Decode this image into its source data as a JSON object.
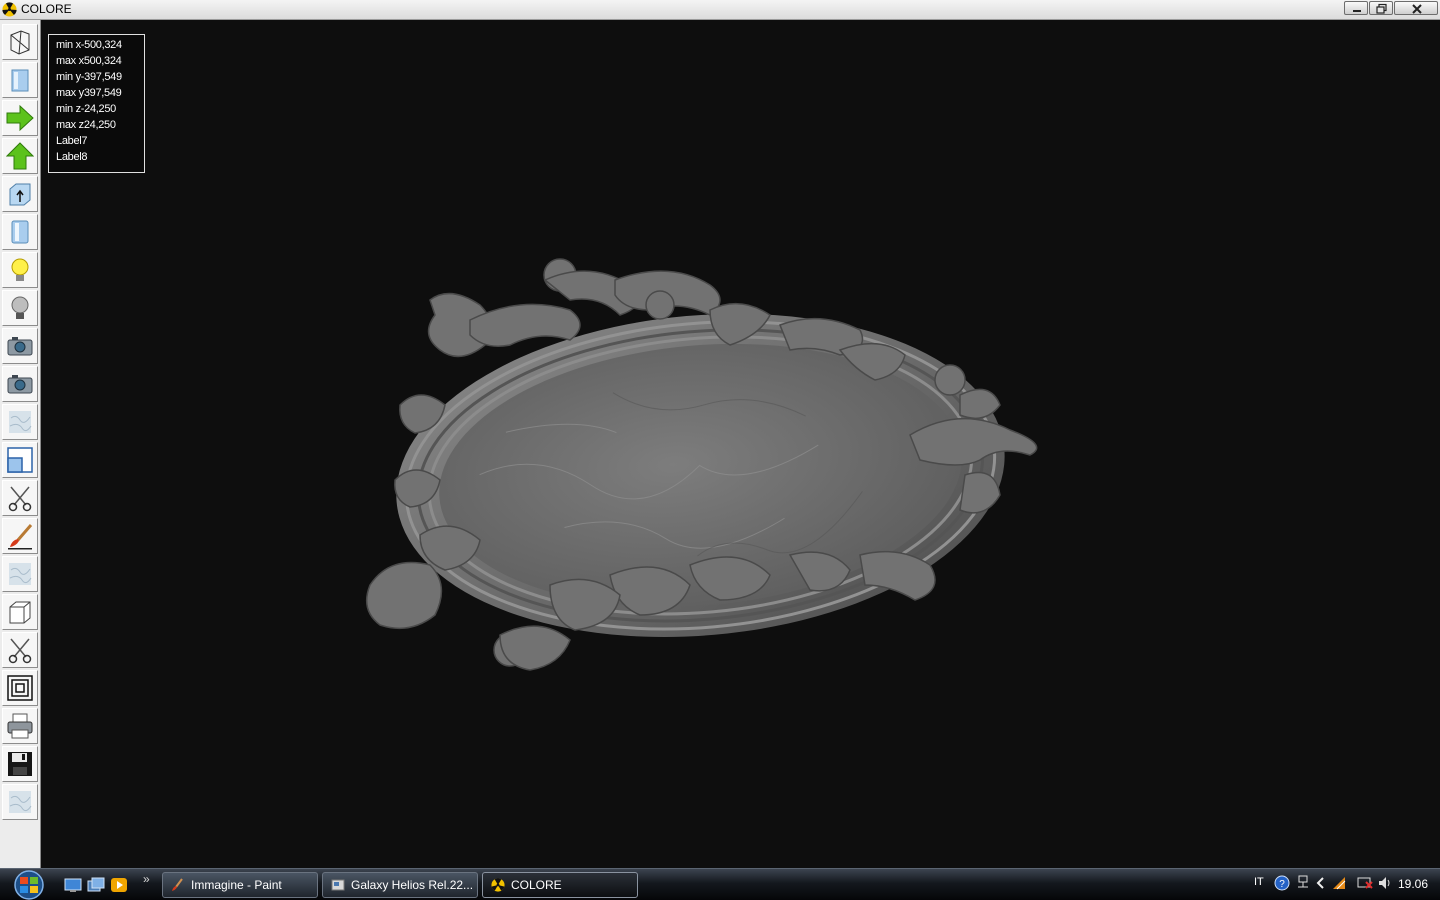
{
  "window": {
    "title": "COLORE",
    "icon": "radiation-icon"
  },
  "window_controls": [
    "minimize",
    "restore",
    "close"
  ],
  "toolbar": {
    "tools": [
      {
        "icon": "wireframe-icon"
      },
      {
        "icon": "solid-box-icon"
      },
      {
        "icon": "arrow-right-icon"
      },
      {
        "icon": "arrow-up-icon"
      },
      {
        "icon": "box-normal-icon"
      },
      {
        "icon": "cylinder-icon"
      },
      {
        "icon": "lightbulb-on-icon"
      },
      {
        "icon": "lightbulb-off-icon"
      },
      {
        "icon": "camera-icon"
      },
      {
        "icon": "camera-2-icon"
      },
      {
        "icon": "texture-icon"
      },
      {
        "icon": "resize-icon"
      },
      {
        "icon": "scissors-icon"
      },
      {
        "icon": "brush-icon"
      },
      {
        "icon": "texture-2-icon"
      },
      {
        "icon": "cube-icon"
      },
      {
        "icon": "scissors-2-icon"
      },
      {
        "icon": "nested-squares-icon"
      },
      {
        "icon": "printer-icon"
      },
      {
        "icon": "floppy-disk-icon"
      },
      {
        "icon": "texture-3-icon"
      }
    ]
  },
  "info_panel": {
    "lines": [
      "min x-500,324",
      "max x500,324",
      "min y-397,549",
      "max y397,549",
      "min z-24,250",
      "max z24,250",
      "Label7",
      "Label8"
    ]
  },
  "colors": {
    "viewport_bg": "#0e0e0e",
    "model_gray": "#6e6e6e"
  },
  "taskbar": {
    "quick_launch": [
      "show-desktop-icon",
      "switch-windows-icon",
      "media-player-icon"
    ],
    "more": "»",
    "tasks": [
      {
        "label": "Immagine - Paint",
        "icon": "paint-icon",
        "active": false
      },
      {
        "label": "Galaxy Helios  Rel.22...",
        "icon": "app-icon",
        "active": false
      },
      {
        "label": "COLORE",
        "icon": "radiation-icon",
        "active": true
      }
    ],
    "tray": {
      "language": "IT",
      "icons": [
        "help-icon",
        "network-icon",
        "chevron-left-icon",
        "shield-icon",
        "security-icon",
        "volume-icon"
      ],
      "time": "19.06"
    }
  }
}
